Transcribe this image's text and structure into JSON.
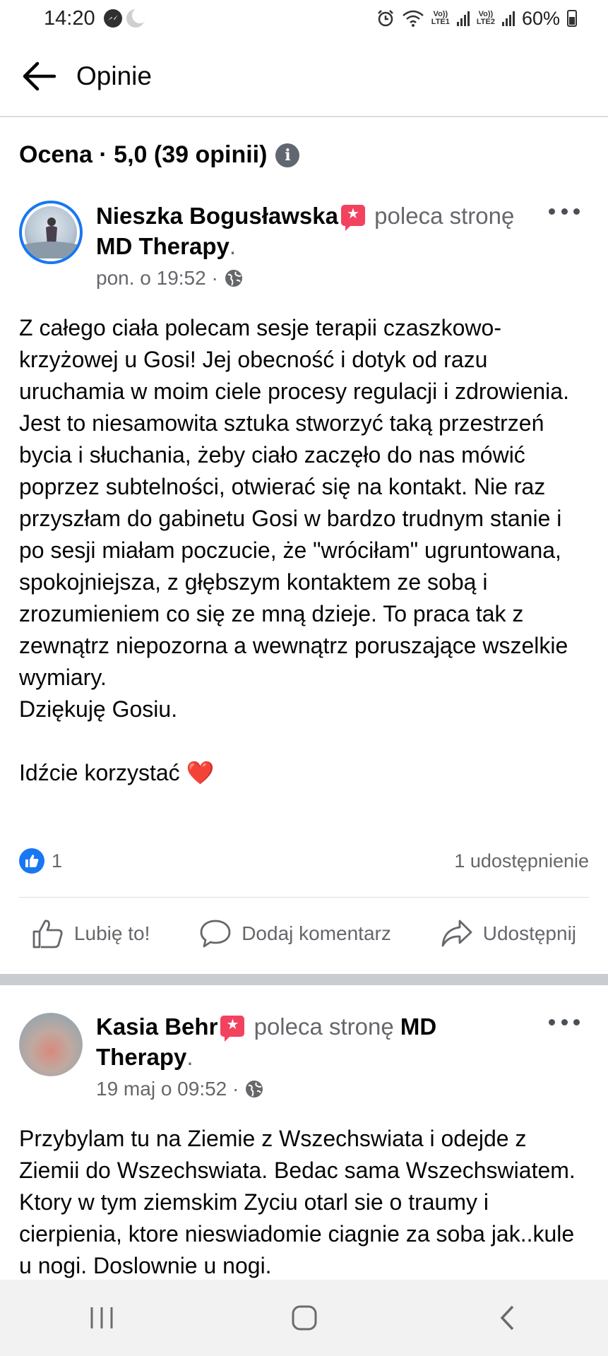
{
  "status_bar": {
    "time": "14:20",
    "battery": "60%",
    "sim1": "Vo)) LTE1",
    "sim2": "Vo)) LTE2"
  },
  "header": {
    "title": "Opinie",
    "back_icon": "arrow-left-icon"
  },
  "rating": {
    "text": "Ocena · 5,0 (39 opinii)",
    "info_icon": "info-icon"
  },
  "posts": [
    {
      "author": "Nieszka Bogusławska",
      "verb": "poleca stronę",
      "page": "MD Therapy",
      "suffix": ".",
      "time": "pon. o 19:52 ·",
      "body": "Z całego ciała polecam sesje terapii czaszkowo-krzyżowej u Gosi! Jej obecność i dotyk od razu uruchamia w moim ciele procesy regulacji i zdrowienia. Jest to niesamowita sztuka stworzyć taką przestrzeń bycia i słuchania, żeby ciało zaczęło do nas mówić poprzez subtelności, otwierać się na kontakt. Nie raz przyszłam do gabinetu Gosi w bardzo trudnym stanie i  po sesji miałam poczucie, że \"wróciłam\" ugruntowana, spokojniejsza, z głębszym kontaktem ze sobą i zrozumieniem co się ze mną dzieje. To praca tak z zewnątrz niepozorna a wewnątrz poruszające wszelkie wymiary.\nDziękuję Gosiu.\n\nIdźcie korzystać ❤️",
      "likes": "1",
      "shares": "1 udostępnienie"
    },
    {
      "author": "Kasia Behr",
      "verb": "poleca stronę",
      "page": "MD Therapy",
      "suffix": ".",
      "time": "19 maj o 09:52 ·",
      "body": "Przybylam tu na Ziemie z Wszechswiata i odejde z Ziemii do Wszechswiata. Bedac sama Wszechswiatem. Ktory w tym ziemskim Zyciu otarl sie o traumy i cierpienia, ktore nieswiadomie ciagnie za soba jak..kule u nogi. Doslownie u nogi."
    }
  ],
  "actions": {
    "like": "Lubię to!",
    "comment": "Dodaj komentarz",
    "share": "Udostępnij"
  },
  "colors": {
    "accent": "#1877f2",
    "recommend_badge": "#f3425f",
    "secondary_text": "#65676b"
  }
}
